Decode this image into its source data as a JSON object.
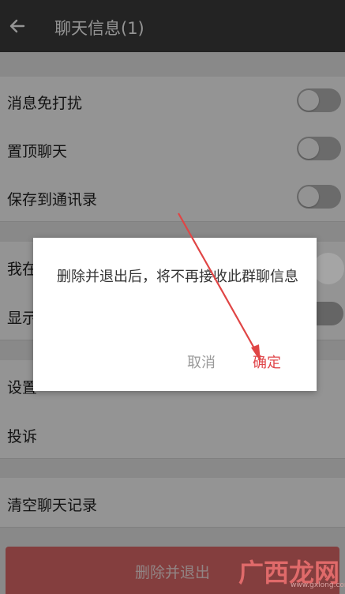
{
  "header": {
    "title": "聊天信息(1)",
    "back_icon": "back-arrow-icon"
  },
  "settings": [
    {
      "label": "消息免打扰",
      "toggle": false
    },
    {
      "label": "置顶聊天",
      "toggle": false
    },
    {
      "label": "保存到通讯录",
      "toggle": false
    }
  ],
  "section2": [
    {
      "label": "我在"
    },
    {
      "label": "显示"
    }
  ],
  "section3": [
    {
      "label": "设置"
    },
    {
      "label": "投诉"
    }
  ],
  "clear_history": "清空聊天记录",
  "delete_button": "删除并退出",
  "dialog": {
    "message": "删除并退出后，将不再接收此群聊信息",
    "cancel": "取消",
    "confirm": "确定"
  },
  "watermark": {
    "brand": "广西龙网",
    "url": "www.gxlong.com"
  },
  "colors": {
    "header_bg": "#3d3d3d",
    "accent": "#e0474b",
    "danger_button": "#e36c6c"
  }
}
